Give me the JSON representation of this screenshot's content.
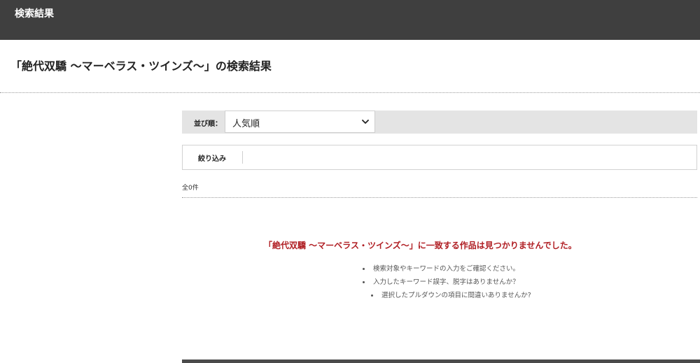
{
  "header": {
    "title": "検索結果"
  },
  "page": {
    "heading": "「絶代双驕 ～マーベラス・ツインズ～」の検索結果"
  },
  "sort": {
    "label": "並び順：",
    "selected": "人気順",
    "icon": "chevron-down-icon"
  },
  "filter": {
    "label": "絞り込み"
  },
  "results": {
    "count_text": "全0件",
    "no_result_message": "「絶代双驕 ～マーベラス・ツインズ～」に一致する作品は見つかりませんでした。",
    "message_color": "#b01e23",
    "hints": [
      "検索対象やキーワードの入力をご確認ください。",
      "入力したキーワード誤字、脱字はありませんか？",
      "選択したプルダウンの項目に間違いありませんか?"
    ]
  },
  "colors": {
    "header_bg": "#3f3f3f",
    "sort_bar_bg": "#e4e4e4",
    "footer_strip": "#4a4a4a"
  }
}
